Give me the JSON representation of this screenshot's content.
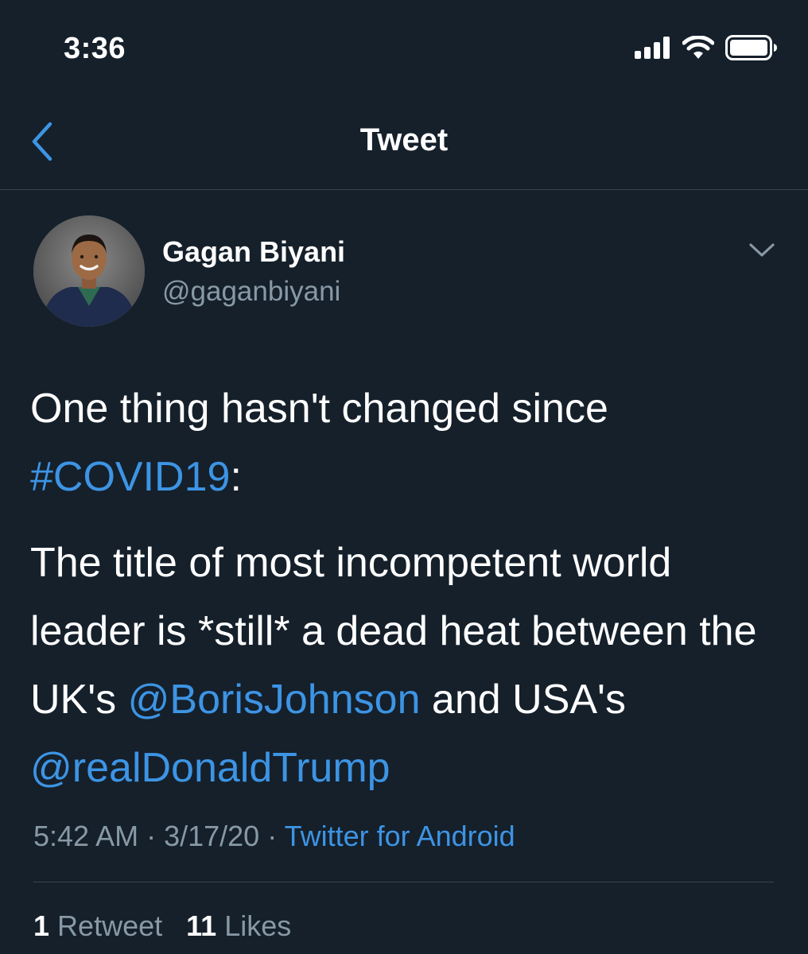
{
  "status_bar": {
    "time": "3:36",
    "icons": [
      "cellular-signal-icon",
      "wifi-icon",
      "battery-icon"
    ]
  },
  "nav": {
    "title": "Tweet",
    "back_icon": "chevron-left-icon"
  },
  "tweet": {
    "author_name": "Gagan Biyani",
    "author_handle": "@gaganbiyani",
    "text_part1": "One thing hasn't changed since ",
    "hashtag": "#COVID19",
    "text_part2": ":",
    "para2_part1": "The title of most incompetent world leader is *still* a dead heat between the UK's ",
    "mention1": "@BorisJohnson",
    "para2_part2": " and USA's ",
    "mention2": "@realDonaldTrump",
    "time": "5:42 AM",
    "separator": " · ",
    "date": "3/17/20",
    "source": "Twitter for Android",
    "retweet_count": "1",
    "retweet_label": "Retweet",
    "like_count": "11",
    "like_label": "Likes"
  },
  "colors": {
    "background": "#15202b",
    "accent": "#3d94e4",
    "secondary_text": "#8899a6",
    "divider": "#38444d"
  }
}
